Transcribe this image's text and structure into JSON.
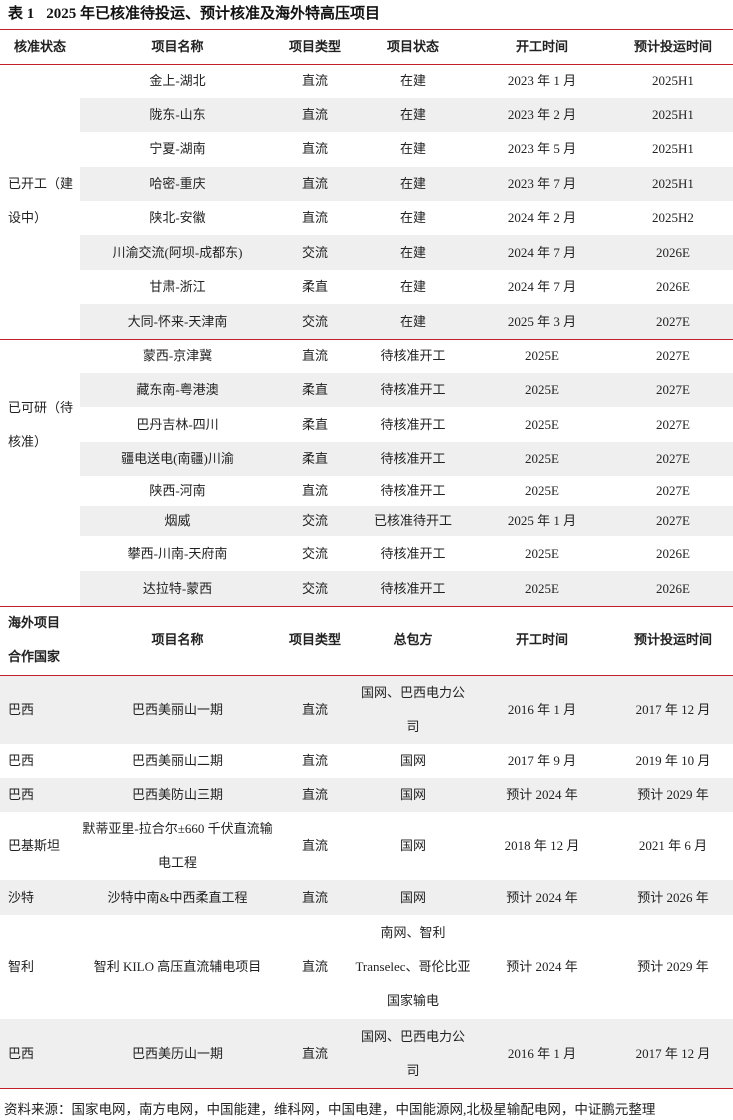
{
  "table_title": {
    "number": "表 1",
    "text": "2025 年已核准待投运、预计核准及海外特高压项目"
  },
  "domestic_headers": [
    "核准状态",
    "项目名称",
    "项目类型",
    "项目状态",
    "开工时间",
    "预计投运时间"
  ],
  "group_built": "已开工（建设中）",
  "group_pending": "已可研（待核准）",
  "domestic_rows": [
    {
      "name": "金上-湖北",
      "type": "直流",
      "status": "在建",
      "start": "2023 年 1 月",
      "op": "2025H1"
    },
    {
      "name": "陇东-山东",
      "type": "直流",
      "status": "在建",
      "start": "2023 年 2 月",
      "op": "2025H1"
    },
    {
      "name": "宁夏-湖南",
      "type": "直流",
      "status": "在建",
      "start": "2023 年 5 月",
      "op": "2025H1"
    },
    {
      "name": "哈密-重庆",
      "type": "直流",
      "status": "在建",
      "start": "2023 年 7 月",
      "op": "2025H1"
    },
    {
      "name": "陕北-安徽",
      "type": "直流",
      "status": "在建",
      "start": "2024 年 2 月",
      "op": "2025H2"
    },
    {
      "name": "川渝交流(阿坝-成都东)",
      "type": "交流",
      "status": "在建",
      "start": "2024 年 7 月",
      "op": "2026E"
    },
    {
      "name": "甘肃-浙江",
      "type": "柔直",
      "status": "在建",
      "start": "2024 年 7 月",
      "op": "2026E"
    },
    {
      "name": "大同-怀来-天津南",
      "type": "交流",
      "status": "在建",
      "start": "2025 年 3 月",
      "op": "2027E"
    },
    {
      "name": "蒙西-京津冀",
      "type": "直流",
      "status": "待核准开工",
      "start": "2025E",
      "op": "2027E"
    },
    {
      "name": "藏东南-粤港澳",
      "type": "柔直",
      "status": "待核准开工",
      "start": "2025E",
      "op": "2027E"
    },
    {
      "name": "巴丹吉林-四川",
      "type": "柔直",
      "status": "待核准开工",
      "start": "2025E",
      "op": "2027E"
    },
    {
      "name": "疆电送电(南疆)川渝",
      "type": "柔直",
      "status": "待核准开工",
      "start": "2025E",
      "op": "2027E"
    },
    {
      "name": "陕西-河南",
      "type": "直流",
      "status": "待核准开工",
      "start": "2025E",
      "op": "2027E"
    },
    {
      "name": "烟威",
      "type": "交流",
      "status": "已核准待开工",
      "start": "2025 年 1 月",
      "op": "2027E"
    },
    {
      "name": "攀西-川南-天府南",
      "type": "交流",
      "status": "待核准开工",
      "start": "2025E",
      "op": "2026E"
    },
    {
      "name": "达拉特-蒙西",
      "type": "交流",
      "status": "待核准开工",
      "start": "2025E",
      "op": "2026E"
    }
  ],
  "overseas_headers": {
    "country_line1": "海外项目",
    "country_line2": "合作国家",
    "name": "项目名称",
    "type": "项目类型",
    "contractor": "总包方",
    "start": "开工时间",
    "op": "预计投运时间"
  },
  "overseas_rows": [
    {
      "country": "巴西",
      "name": "巴西美丽山一期",
      "type": "直流",
      "contractor": "国网、巴西电力公司",
      "start": "2016 年 1 月",
      "op": "2017 年 12 月"
    },
    {
      "country": "巴西",
      "name": "巴西美丽山二期",
      "type": "直流",
      "contractor": "国网",
      "start": "2017 年 9 月",
      "op": "2019 年 10 月"
    },
    {
      "country": "巴西",
      "name": "巴西美防山三期",
      "type": "直流",
      "contractor": "国网",
      "start": "预计 2024 年",
      "op": "预计 2029 年"
    },
    {
      "country": "巴基斯坦",
      "name": "默蒂亚里-拉合尔±660 千伏直流输电工程",
      "type": "直流",
      "contractor": "国网",
      "start": "2018 年 12 月",
      "op": "2021 年 6 月"
    },
    {
      "country": "沙特",
      "name": "沙特中南&中西柔直工程",
      "type": "直流",
      "contractor": "国网",
      "start": "预计 2024 年",
      "op": "预计 2026 年"
    },
    {
      "country": "智利",
      "name": "智利 KILO 高压直流辅电项目",
      "type": "直流",
      "contractor": "南网、智利 Transelec、哥伦比亚国家输电",
      "start": "预计 2024 年",
      "op": "预计 2029 年"
    },
    {
      "country": "巴西",
      "name": "巴西美历山一期",
      "type": "直流",
      "contractor": "国网、巴西电力公司",
      "start": "2016 年 1 月",
      "op": "2017 年 12 月"
    }
  ],
  "source": "资料来源：国家电网，南方电网，中国能建，维科网，中国电建，中国能源网,北极星输配电网，中证鹏元整理"
}
